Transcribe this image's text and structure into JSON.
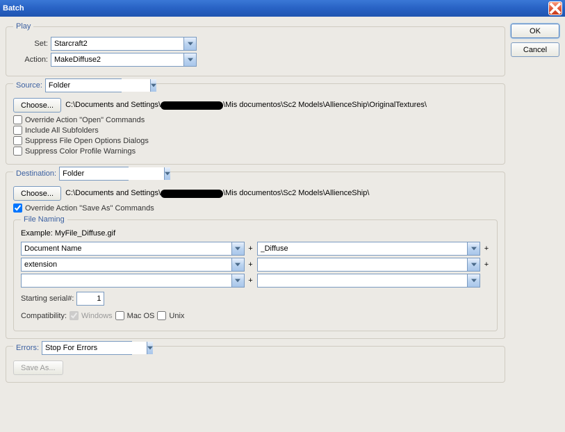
{
  "window": {
    "title": "Batch",
    "ok": "OK",
    "cancel": "Cancel"
  },
  "play": {
    "legend": "Play",
    "set_label": "Set:",
    "set_value": "Starcraft2",
    "action_label": "Action:",
    "action_value": "MakeDiffuse2"
  },
  "source": {
    "legend": "Source:",
    "type": "Folder",
    "choose": "Choose...",
    "path_prefix": "C:\\Documents and Settings\\",
    "path_suffix": "\\Mis documentos\\Sc2 Models\\AllienceShip\\OriginalTextures\\",
    "opt_override": "Override Action \"Open\" Commands",
    "opt_subfolders": "Include All Subfolders",
    "opt_suppress_open": "Suppress File Open Options Dialogs",
    "opt_suppress_color": "Suppress Color Profile Warnings"
  },
  "destination": {
    "legend": "Destination:",
    "type": "Folder",
    "choose": "Choose...",
    "path_prefix": "C:\\Documents and Settings\\",
    "path_suffix": "\\Mis documentos\\Sc2 Models\\AllienceShip\\",
    "opt_override": "Override Action \"Save As\" Commands"
  },
  "naming": {
    "legend": "File Naming",
    "example_label": "Example:",
    "example_value": "MyFile_Diffuse.gif",
    "f1": "Document Name",
    "f2": "_Diffuse",
    "f3": "extension",
    "f4": "",
    "f5": "",
    "f6": "",
    "serial_label": "Starting serial#:",
    "serial_value": "1",
    "compat_label": "Compatibility:",
    "compat_windows": "Windows",
    "compat_mac": "Mac OS",
    "compat_unix": "Unix"
  },
  "errors": {
    "legend": "Errors:",
    "value": "Stop For Errors",
    "save_as": "Save As..."
  }
}
